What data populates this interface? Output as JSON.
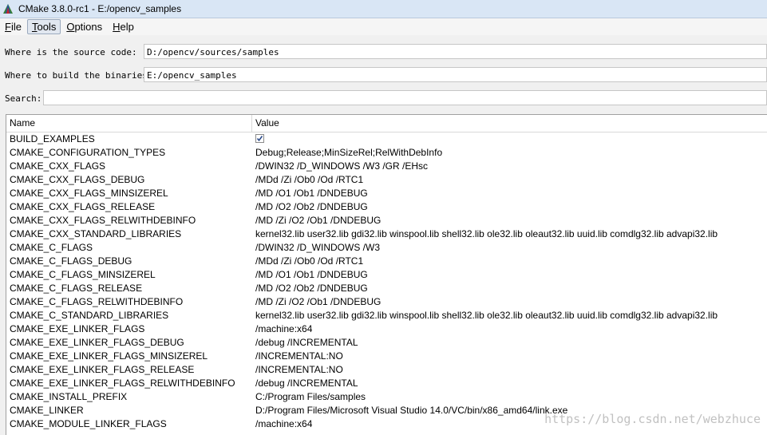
{
  "window": {
    "title": "CMake 3.8.0-rc1 - E:/opencv_samples"
  },
  "menu": [
    {
      "pre": "",
      "ul": "F",
      "post": "ile",
      "active": false
    },
    {
      "pre": "",
      "ul": "T",
      "post": "ools",
      "active": true
    },
    {
      "pre": "",
      "ul": "O",
      "post": "ptions",
      "active": false
    },
    {
      "pre": "",
      "ul": "H",
      "post": "elp",
      "active": false
    }
  ],
  "source": {
    "label": "Where is the source code:",
    "value": "D:/opencv/sources/samples"
  },
  "build": {
    "label": "Where to build the binaries:",
    "value": "E:/opencv_samples"
  },
  "search": {
    "label": "Search:",
    "value": ""
  },
  "table": {
    "columns": {
      "name": "Name",
      "value": "Value"
    },
    "rows": [
      {
        "name": "BUILD_EXAMPLES",
        "value": "",
        "checkbox": true,
        "checked": true
      },
      {
        "name": "CMAKE_CONFIGURATION_TYPES",
        "value": "Debug;Release;MinSizeRel;RelWithDebInfo"
      },
      {
        "name": "CMAKE_CXX_FLAGS",
        "value": "/DWIN32 /D_WINDOWS /W3 /GR /EHsc"
      },
      {
        "name": "CMAKE_CXX_FLAGS_DEBUG",
        "value": "/MDd /Zi /Ob0 /Od /RTC1"
      },
      {
        "name": "CMAKE_CXX_FLAGS_MINSIZEREL",
        "value": "/MD /O1 /Ob1 /DNDEBUG"
      },
      {
        "name": "CMAKE_CXX_FLAGS_RELEASE",
        "value": "/MD /O2 /Ob2 /DNDEBUG"
      },
      {
        "name": "CMAKE_CXX_FLAGS_RELWITHDEBINFO",
        "value": "/MD /Zi /O2 /Ob1 /DNDEBUG"
      },
      {
        "name": "CMAKE_CXX_STANDARD_LIBRARIES",
        "value": "kernel32.lib user32.lib gdi32.lib winspool.lib shell32.lib ole32.lib oleaut32.lib uuid.lib comdlg32.lib advapi32.lib"
      },
      {
        "name": "CMAKE_C_FLAGS",
        "value": "/DWIN32 /D_WINDOWS /W3"
      },
      {
        "name": "CMAKE_C_FLAGS_DEBUG",
        "value": "/MDd /Zi /Ob0 /Od /RTC1"
      },
      {
        "name": "CMAKE_C_FLAGS_MINSIZEREL",
        "value": "/MD /O1 /Ob1 /DNDEBUG"
      },
      {
        "name": "CMAKE_C_FLAGS_RELEASE",
        "value": "/MD /O2 /Ob2 /DNDEBUG"
      },
      {
        "name": "CMAKE_C_FLAGS_RELWITHDEBINFO",
        "value": "/MD /Zi /O2 /Ob1 /DNDEBUG"
      },
      {
        "name": "CMAKE_C_STANDARD_LIBRARIES",
        "value": "kernel32.lib user32.lib gdi32.lib winspool.lib shell32.lib ole32.lib oleaut32.lib uuid.lib comdlg32.lib advapi32.lib"
      },
      {
        "name": "CMAKE_EXE_LINKER_FLAGS",
        "value": "/machine:x64"
      },
      {
        "name": "CMAKE_EXE_LINKER_FLAGS_DEBUG",
        "value": "/debug /INCREMENTAL"
      },
      {
        "name": "CMAKE_EXE_LINKER_FLAGS_MINSIZEREL",
        "value": "/INCREMENTAL:NO"
      },
      {
        "name": "CMAKE_EXE_LINKER_FLAGS_RELEASE",
        "value": "/INCREMENTAL:NO"
      },
      {
        "name": "CMAKE_EXE_LINKER_FLAGS_RELWITHDEBINFO",
        "value": "/debug /INCREMENTAL"
      },
      {
        "name": "CMAKE_INSTALL_PREFIX",
        "value": "C:/Program Files/samples"
      },
      {
        "name": "CMAKE_LINKER",
        "value": "D:/Program Files/Microsoft Visual Studio 14.0/VC/bin/x86_amd64/link.exe"
      },
      {
        "name": "CMAKE_MODULE_LINKER_FLAGS",
        "value": "/machine:x64"
      }
    ]
  },
  "watermark": "https://blog.csdn.net/webzhuce"
}
